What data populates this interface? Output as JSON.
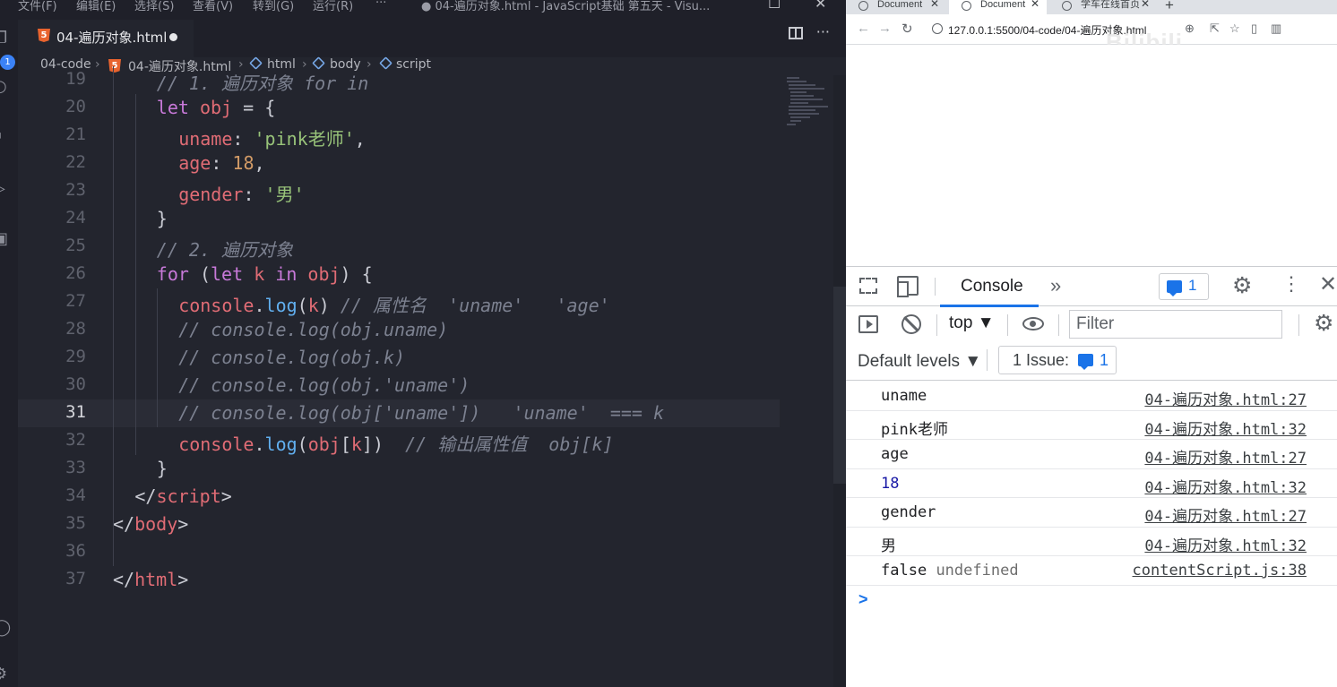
{
  "editor_window": {
    "menu": [
      "文件(F)",
      "编辑(E)",
      "选择(S)",
      "查看(V)",
      "转到(G)",
      "运行(R)",
      "···"
    ],
    "title": "● 04-遍历对象.html - JavaScript基础 第五天 - Visu...",
    "activity_badge": "1",
    "tab_label": "04-遍历对象.html",
    "breadcrumb": [
      "04-code",
      "04-遍历对象.html",
      "html",
      "body",
      "script"
    ],
    "current_line": 31
  },
  "code_lines": [
    {
      "n": "19",
      "segments": [
        {
          "c": "cm",
          "t": "// 1. 遍历对象 for in"
        }
      ]
    },
    {
      "n": "20",
      "segments": [
        {
          "c": "kw",
          "t": "let "
        },
        {
          "c": "var",
          "t": "obj"
        },
        {
          "c": "pun",
          "t": " = {"
        }
      ]
    },
    {
      "n": "21",
      "segments": [
        {
          "c": "prop",
          "t": "uname"
        },
        {
          "c": "pun",
          "t": ": "
        },
        {
          "c": "str",
          "t": "'pink老师'"
        },
        {
          "c": "pun",
          "t": ","
        }
      ]
    },
    {
      "n": "22",
      "segments": [
        {
          "c": "prop",
          "t": "age"
        },
        {
          "c": "pun",
          "t": ": "
        },
        {
          "c": "num",
          "t": "18"
        },
        {
          "c": "pun",
          "t": ","
        }
      ]
    },
    {
      "n": "23",
      "segments": [
        {
          "c": "prop",
          "t": "gender"
        },
        {
          "c": "pun",
          "t": ": "
        },
        {
          "c": "str",
          "t": "'男'"
        }
      ]
    },
    {
      "n": "24",
      "segments": [
        {
          "c": "pun",
          "t": "}"
        }
      ]
    },
    {
      "n": "25",
      "segments": [
        {
          "c": "cm",
          "t": "// 2. 遍历对象"
        }
      ]
    },
    {
      "n": "26",
      "segments": [
        {
          "c": "kw",
          "t": "for "
        },
        {
          "c": "pun",
          "t": "("
        },
        {
          "c": "kw",
          "t": "let "
        },
        {
          "c": "var",
          "t": "k"
        },
        {
          "c": "kw",
          "t": " in "
        },
        {
          "c": "var",
          "t": "obj"
        },
        {
          "c": "pun",
          "t": ") {"
        }
      ]
    },
    {
      "n": "27",
      "segments": [
        {
          "c": "var",
          "t": "console"
        },
        {
          "c": "pun",
          "t": "."
        },
        {
          "c": "fn",
          "t": "log"
        },
        {
          "c": "pun",
          "t": "("
        },
        {
          "c": "var",
          "t": "k"
        },
        {
          "c": "pun",
          "t": ") "
        },
        {
          "c": "cm",
          "t": "// 属性名  'uname'   'age'"
        }
      ]
    },
    {
      "n": "28",
      "segments": [
        {
          "c": "cm",
          "t": "// console.log(obj.uname)"
        }
      ]
    },
    {
      "n": "29",
      "segments": [
        {
          "c": "cm",
          "t": "// console.log(obj.k)"
        }
      ]
    },
    {
      "n": "30",
      "segments": [
        {
          "c": "cm",
          "t": "// console.log(obj.'uname')"
        }
      ]
    },
    {
      "n": "31",
      "segments": [
        {
          "c": "cm",
          "t": "// console.log(obj['uname'])   'uname'  === k"
        }
      ]
    },
    {
      "n": "32",
      "segments": [
        {
          "c": "var",
          "t": "console"
        },
        {
          "c": "pun",
          "t": "."
        },
        {
          "c": "fn",
          "t": "log"
        },
        {
          "c": "pun",
          "t": "("
        },
        {
          "c": "var",
          "t": "obj"
        },
        {
          "c": "pun",
          "t": "["
        },
        {
          "c": "var",
          "t": "k"
        },
        {
          "c": "pun",
          "t": "])  "
        },
        {
          "c": "cm",
          "t": "// 输出属性值  obj[k]"
        }
      ]
    },
    {
      "n": "33",
      "segments": [
        {
          "c": "pun",
          "t": "}"
        }
      ]
    },
    {
      "n": "34",
      "segments": [
        {
          "c": "pun",
          "t": "</"
        },
        {
          "c": "tag",
          "t": "script"
        },
        {
          "c": "pun",
          "t": ">"
        }
      ]
    },
    {
      "n": "35",
      "segments": [
        {
          "c": "pun",
          "t": "</"
        },
        {
          "c": "tag",
          "t": "body"
        },
        {
          "c": "pun",
          "t": ">"
        }
      ]
    },
    {
      "n": "36",
      "segments": []
    },
    {
      "n": "37",
      "segments": [
        {
          "c": "pun",
          "t": "</"
        },
        {
          "c": "tag",
          "t": "html"
        },
        {
          "c": "pun",
          "t": ">"
        }
      ]
    }
  ],
  "browser": {
    "tabs": [
      "Document",
      "Document",
      "学车在线首页"
    ],
    "new_tab": "+",
    "url": "127.0.0.1:5500/04-code/04-遍历对象.html",
    "watermark": "Bilibili"
  },
  "devtools": {
    "tab_console": "Console",
    "more_tabs": "»",
    "issues_badge_count": "1",
    "context": "top ▼",
    "filter_placeholder": "Filter",
    "levels": "Default levels ▼",
    "issues_button_label": "1 Issue:",
    "issues_button_count": "1",
    "log": [
      {
        "msg": "uname",
        "type": "text",
        "src": "04-遍历对象.html:27"
      },
      {
        "msg": "pink老师",
        "type": "text",
        "src": "04-遍历对象.html:32"
      },
      {
        "msg": "age",
        "type": "text",
        "src": "04-遍历对象.html:27"
      },
      {
        "msg": "18",
        "type": "num",
        "src": "04-遍历对象.html:32"
      },
      {
        "msg": "gender",
        "type": "text",
        "src": "04-遍历对象.html:27"
      },
      {
        "msg": "男",
        "type": "text",
        "src": "04-遍历对象.html:32"
      },
      {
        "msg": "false",
        "extra": "undefined",
        "type": "text",
        "src": "contentScript.js:38"
      }
    ],
    "prompt": ">"
  },
  "colors": {
    "editor_bg": "#23252e",
    "keyword": "#c879d9",
    "variable": "#e06c75",
    "string": "#98c379",
    "number": "#d19a66",
    "function": "#61afef",
    "comment": "#7c8190",
    "accent_blue": "#1a73e8"
  }
}
